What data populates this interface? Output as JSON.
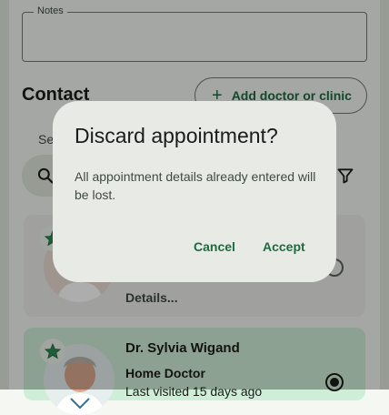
{
  "notes": {
    "label": "Notes"
  },
  "contact": {
    "title": "Contact",
    "add_button_label": "Add doctor or clinic",
    "search_hint": "Se"
  },
  "cards": [
    {
      "name": "",
      "role": "",
      "details_label": "Details...",
      "selected": false,
      "favorite": true
    },
    {
      "name": "Dr. Sylvia Wigand",
      "role": "Home Doctor",
      "last_visited": "Last visited 15 days ago",
      "selected": true,
      "favorite": true
    }
  ],
  "dialog": {
    "title": "Discard appointment?",
    "body": "All appointment details already entered will be lost.",
    "cancel_label": "Cancel",
    "accept_label": "Accept"
  },
  "colors": {
    "accent": "#1d6b3f",
    "selected_card": "#cfeed7",
    "dialog_surface": "#e8ebe5"
  }
}
